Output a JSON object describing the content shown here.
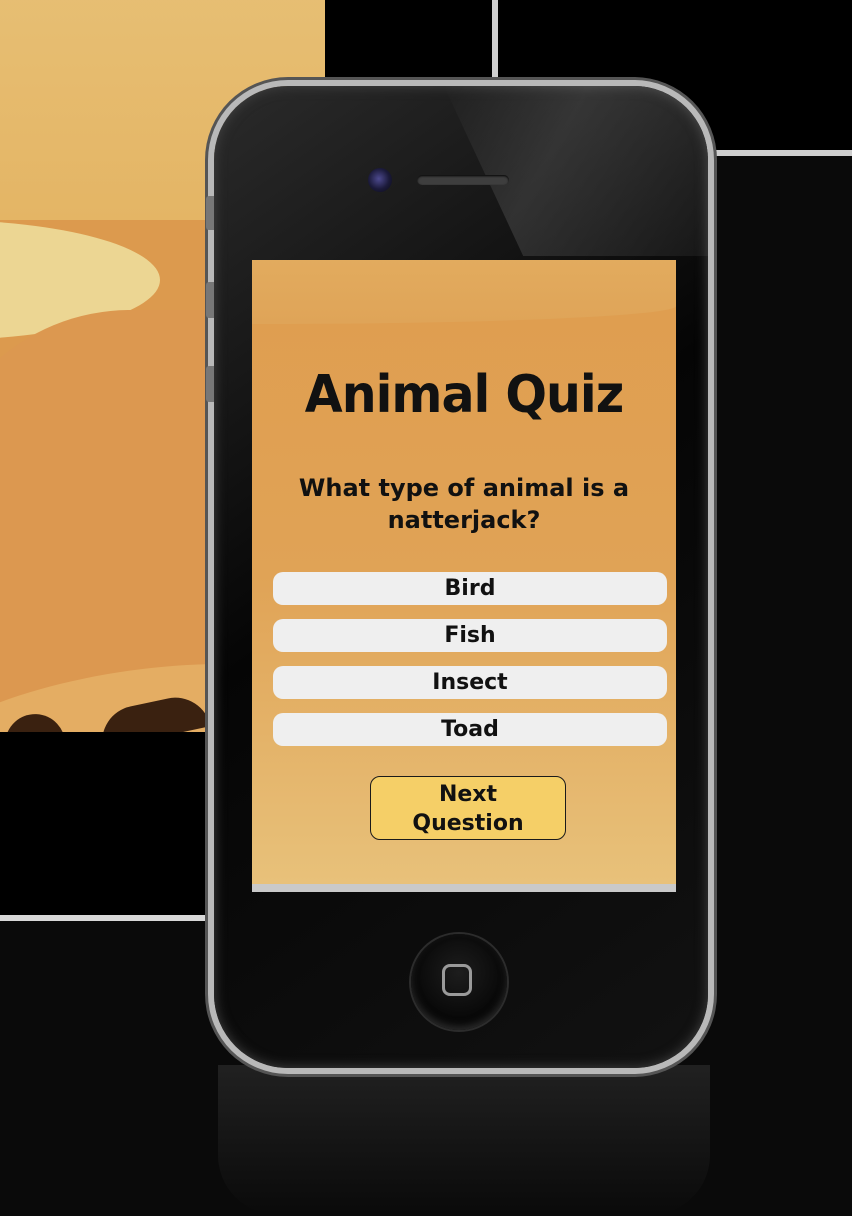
{
  "app": {
    "title": "Animal Quiz",
    "question": "What type of animal is a natterjack?",
    "answers": [
      {
        "label": "Bird"
      },
      {
        "label": "Fish"
      },
      {
        "label": "Insect"
      },
      {
        "label": "Toad"
      }
    ],
    "next_button": {
      "line1": "Next",
      "line2": "Question"
    }
  },
  "colors": {
    "screen_bg": "#df9d4f",
    "answer_bg": "#efefef",
    "next_bg": "#f5cf67",
    "text": "#111111"
  },
  "icons": {
    "camera": "front-camera-icon",
    "home": "home-button-icon"
  }
}
